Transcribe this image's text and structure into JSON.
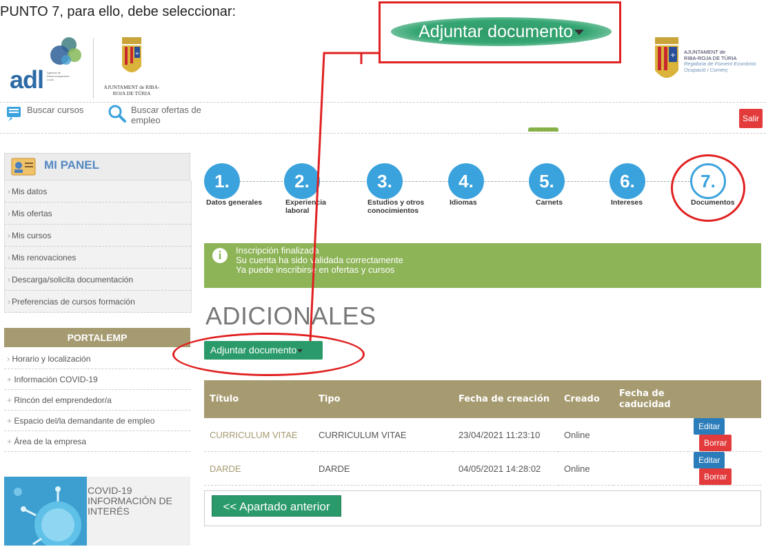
{
  "instruction": "PUNTO 7, para ello, debe seleccionar:",
  "zoom": {
    "button_label": "Adjuntar documento"
  },
  "logos": {
    "adl": "adl",
    "adl_subtitle": "Agència de Desenvolupament Local",
    "ajuntament_left": "AJUNTAMENT de RIBA-ROJA DE TÚRIA",
    "ajuntament_right_line1": "AJUNTAMENT de",
    "ajuntament_right_line2": "RIBA-ROJA DE TÚRIA",
    "ajuntament_right_sub1": "Regidoria de Foment Econòmic",
    "ajuntament_right_sub2": "Ocupació i Comerç"
  },
  "nav": {
    "search_courses": "Buscar cursos",
    "search_offers": "Buscar ofertas de empleo",
    "logout": "Salir"
  },
  "sidebar": {
    "panel_title": "MI PANEL",
    "items": [
      {
        "label": "Mis datos"
      },
      {
        "label": "Mis ofertas"
      },
      {
        "label": "Mis cursos"
      },
      {
        "label": "Mis renovaciones"
      },
      {
        "label": "Descarga/solicita documentación"
      },
      {
        "label": "Preferencias de cursos formación"
      }
    ],
    "portal_title": "PORTALEMP",
    "portal_items": [
      {
        "label": "Horario y localización"
      },
      {
        "label": "Información COVID-19"
      },
      {
        "label": "Rincón del emprendedor/a"
      },
      {
        "label": "Espacio del/la demandante de empleo"
      },
      {
        "label": "Área de la empresa"
      }
    ],
    "covid_line1": "COVID-19",
    "covid_line2": "INFORMACIÓN DE",
    "covid_line3": "INTERÉS"
  },
  "steps": [
    {
      "number": "1.",
      "label": "Datos generales"
    },
    {
      "number": "2.",
      "label": "Experiencia laboral"
    },
    {
      "number": "3.",
      "label": "Estudios y otros conocimientos"
    },
    {
      "number": "4.",
      "label": "Idiomas"
    },
    {
      "number": "5.",
      "label": "Carnets"
    },
    {
      "number": "6.",
      "label": "Intereses"
    },
    {
      "number": "7.",
      "label": "Documentos"
    }
  ],
  "banner": {
    "line1": "Inscripción finalizada",
    "line2": "Su cuenta ha sido validada correctamente",
    "line3": "Ya puede inscribirse en ofertas y cursos"
  },
  "section_title": "ADICIONALES",
  "attach_button": "Adjuntar documento",
  "table": {
    "headers": [
      "Título",
      "Tipo",
      "Fecha de creación",
      "Creado",
      "Fecha de caducidad"
    ],
    "rows": [
      {
        "title": "CURRICULUM VITAE",
        "type": "CURRICULUM VITAE",
        "created": "23/04/2021 11:23:10",
        "by": "Online",
        "expiry": ""
      },
      {
        "title": "DARDE",
        "type": "DARDE",
        "created": "04/05/2021 14:28:02",
        "by": "Online",
        "expiry": ""
      }
    ],
    "edit_label": "Editar",
    "delete_label": "Borrar"
  },
  "prev_button": "<< Apartado anterior",
  "colors": {
    "accent_red": "#e02020",
    "step_blue": "#3aa2dc",
    "banner_green": "#8db457",
    "button_green": "#2a9a6a",
    "table_header": "#a69a70"
  }
}
